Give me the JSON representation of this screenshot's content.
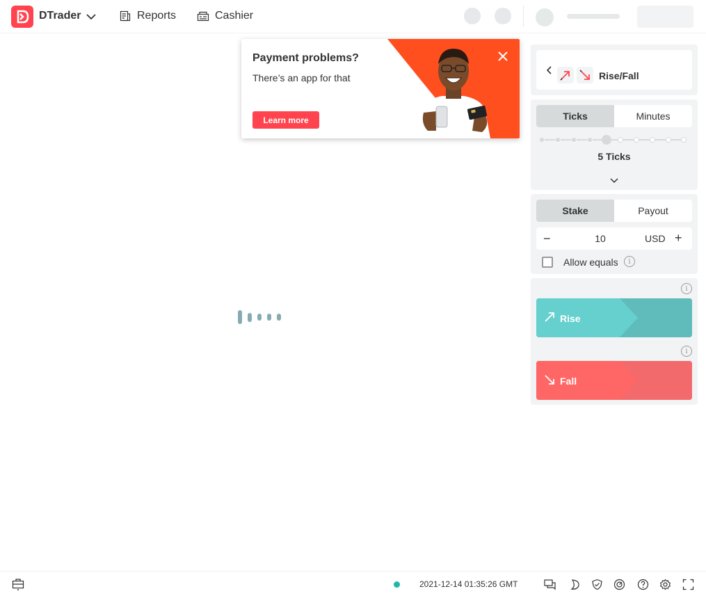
{
  "header": {
    "app_name": "DTrader",
    "nav": {
      "reports": "Reports",
      "cashier": "Cashier"
    }
  },
  "banner": {
    "title": "Payment problems?",
    "subtitle": "There’s an app for that",
    "cta": "Learn more",
    "accent": "#ff4f1f"
  },
  "trade": {
    "contract_type": "Rise/Fall",
    "duration_tabs": [
      "Ticks",
      "Minutes"
    ],
    "duration_active": "Ticks",
    "duration_value": 5,
    "duration_label": "5 Ticks",
    "amount_tabs": [
      "Stake",
      "Payout"
    ],
    "amount_active": "Stake",
    "stake_value": "10",
    "currency": "USD",
    "allow_equals_label": "Allow equals",
    "allow_equals_checked": false,
    "rise_label": "Rise",
    "fall_label": "Fall"
  },
  "footer": {
    "server_time": "2021-12-14 01:35:26 GMT",
    "network_status_color": "#21b6ad"
  },
  "colors": {
    "brand": "#ff444f",
    "rise": "#4bb4b3",
    "fall": "#ec3f3f"
  }
}
